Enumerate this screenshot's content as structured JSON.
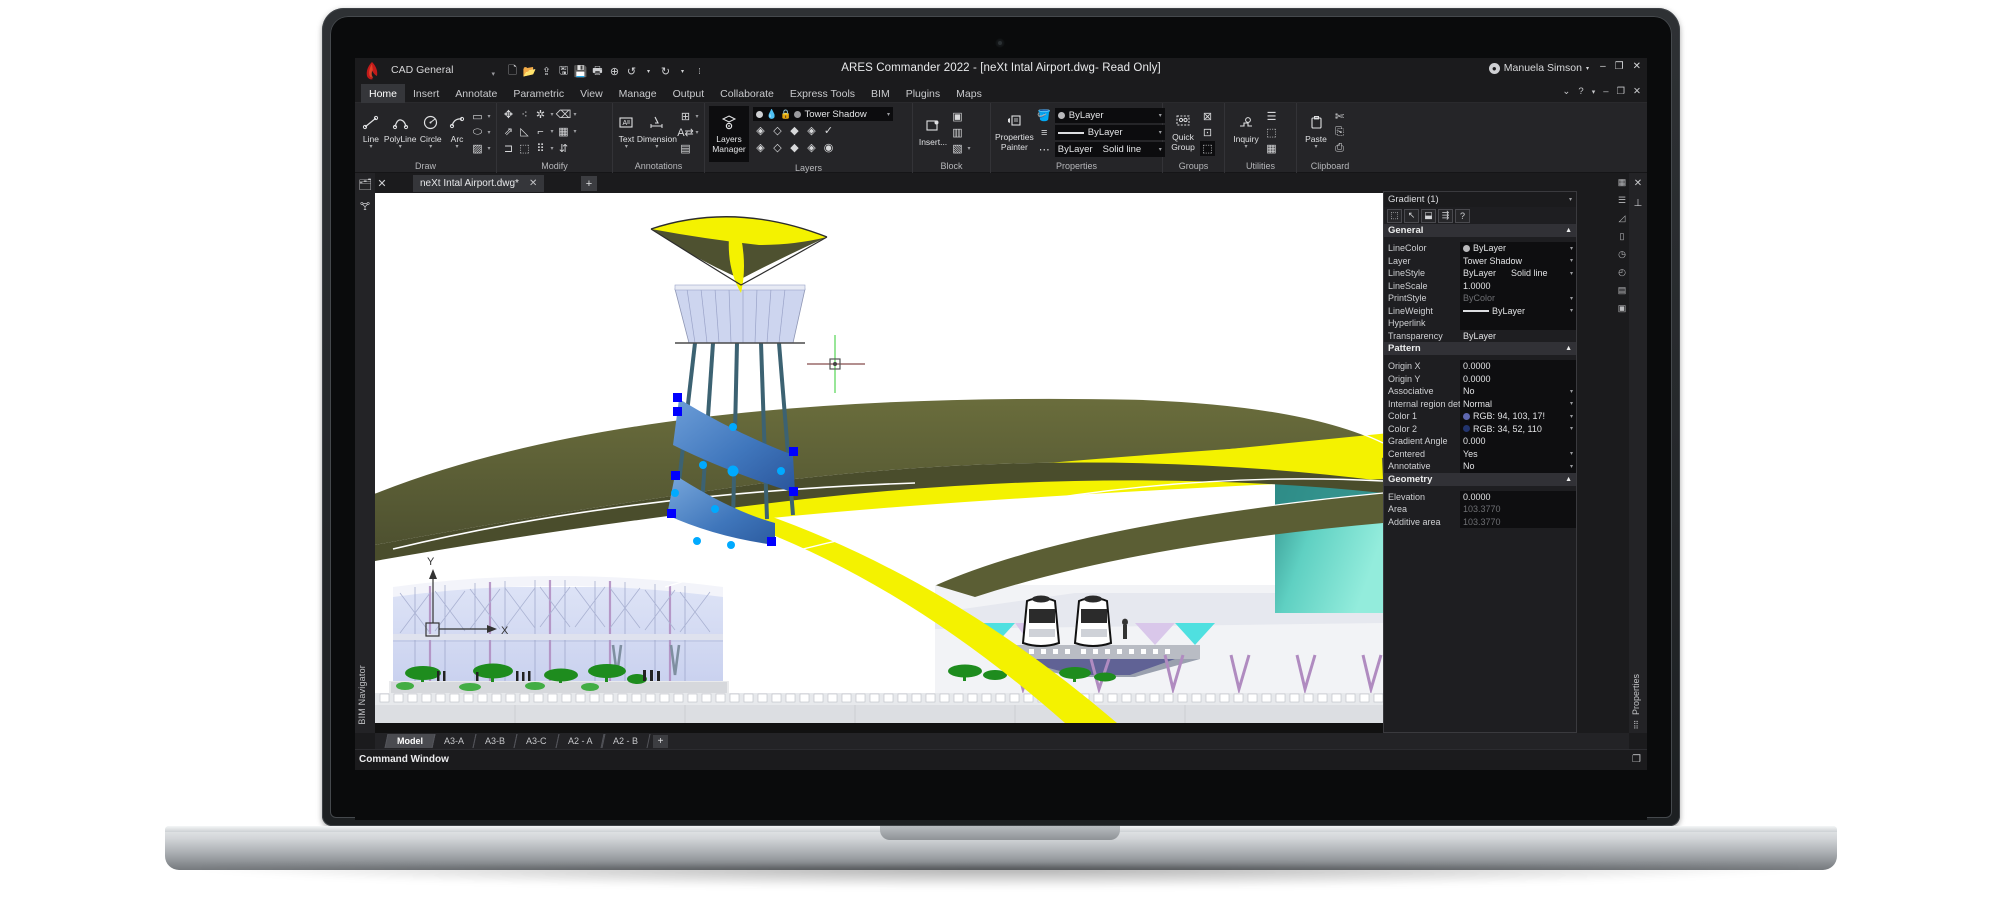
{
  "app": {
    "title": "ARES Commander 2022 - [neXt Intal Airport.dwg- Read Only]",
    "workspace": "CAD General",
    "user": "Manuela Simson",
    "user_icon": "user-circle-icon",
    "logo_icon": "ares-flame-logo"
  },
  "quick_access": [
    {
      "icon": "new-file-icon",
      "name": "new"
    },
    {
      "icon": "open-folder-icon",
      "name": "open"
    },
    {
      "icon": "open-recent-icon",
      "name": "open-recent"
    },
    {
      "icon": "save-as-icon",
      "name": "save-as"
    },
    {
      "icon": "save-icon",
      "name": "save"
    },
    {
      "icon": "print-icon",
      "name": "print"
    },
    {
      "icon": "print-preview-icon",
      "name": "print-preview"
    },
    {
      "icon": "undo-icon",
      "name": "undo"
    },
    {
      "icon": "caret-down-icon",
      "name": "undo-menu"
    },
    {
      "icon": "redo-icon",
      "name": "redo"
    },
    {
      "icon": "caret-down-icon",
      "name": "redo-menu"
    },
    {
      "icon": "more-icon",
      "name": "customize"
    }
  ],
  "window_buttons": {
    "minimize": "–",
    "restore": "❐",
    "close": "✕"
  },
  "ribbon_tabs": [
    {
      "label": "Home",
      "active": true
    },
    {
      "label": "Insert",
      "active": false
    },
    {
      "label": "Annotate",
      "active": false
    },
    {
      "label": "Parametric",
      "active": false
    },
    {
      "label": "View",
      "active": false
    },
    {
      "label": "Manage",
      "active": false
    },
    {
      "label": "Output",
      "active": false
    },
    {
      "label": "Collaborate",
      "active": false
    },
    {
      "label": "Express Tools",
      "active": false
    },
    {
      "label": "BIM",
      "active": false
    },
    {
      "label": "Plugins",
      "active": false
    },
    {
      "label": "Maps",
      "active": false
    }
  ],
  "ribbon_right": [
    "⌄",
    "?",
    "•",
    "–",
    "❐",
    "✕"
  ],
  "ribbon_groups": {
    "draw": {
      "label": "Draw",
      "big": [
        {
          "label": "Line",
          "icon": "line-icon"
        },
        {
          "label": "PolyLine",
          "icon": "polyline-icon"
        },
        {
          "label": "Circle",
          "icon": "circle-icon"
        },
        {
          "label": "Arc",
          "icon": "arc-icon"
        }
      ],
      "small": [
        {
          "icon": "rectangle-icon"
        },
        {
          "icon": "ellipse-icon"
        },
        {
          "icon": "hatch-icon"
        }
      ]
    },
    "modify": {
      "label": "Modify",
      "small": [
        {
          "icon": "move-icon"
        },
        {
          "icon": "copy-icon"
        },
        {
          "icon": "explode-icon"
        },
        {
          "icon": "erase-icon"
        },
        {
          "icon": "stretch-icon"
        },
        {
          "icon": "mirror-icon"
        },
        {
          "icon": "trim-icon"
        },
        {
          "icon": "fillet-icon"
        },
        {
          "icon": "offset-icon"
        },
        {
          "icon": "scale-icon"
        },
        {
          "icon": "array-icon"
        },
        {
          "icon": "align-icon"
        }
      ]
    },
    "annotations": {
      "label": "Annotations",
      "big": [
        {
          "label": "Text",
          "icon": "text-icon"
        },
        {
          "label": "Dimension",
          "icon": "dimension-icon"
        }
      ],
      "small": [
        {
          "icon": "table-icon"
        },
        {
          "icon": "text-style-icon"
        },
        {
          "icon": "table-style-icon"
        }
      ]
    },
    "layers": {
      "label": "Layers",
      "manager_label_line1": "Layers",
      "manager_label_line2": "Manager",
      "manager_icon": "layers-gear-icon",
      "current_layer": "Tower Shadow",
      "layer_state_icons": [
        "lamp-icon",
        "water-drop-icon",
        "lock-icon",
        "color-dot-icon"
      ],
      "tool_icons": [
        "layer-off-icon",
        "layer-freeze-icon",
        "layer-lock-icon",
        "layer-locked-icon",
        "layer-check-icon",
        "layer-on-icon",
        "layer-thaw-icon",
        "layer-isolate-icon",
        "layer-unlock-icon",
        "layer-previous-icon"
      ]
    },
    "block": {
      "label": "Block",
      "big": [
        {
          "label": "Insert...",
          "icon": "insert-block-icon"
        }
      ],
      "small": [
        {
          "icon": "create-block-icon"
        },
        {
          "icon": "edit-block-icon"
        },
        {
          "icon": "block-attributes-icon"
        }
      ]
    },
    "properties": {
      "label": "Properties",
      "big": [
        {
          "label_line1": "Properties",
          "label_line2": "Painter",
          "icon": "properties-painter-icon"
        }
      ],
      "small": [
        {
          "icon": "paint-bucket-icon"
        },
        {
          "icon": "lineweight-icon"
        },
        {
          "icon": "linestyle-icon"
        }
      ],
      "combos": [
        {
          "name": "line-color",
          "swatch": "#b9b9bc",
          "value": "ByLayer",
          "icon": "color-dot-icon"
        },
        {
          "name": "line-weight",
          "swatch": "",
          "value": "ByLayer",
          "icon": "line-weight-icon"
        },
        {
          "name": "line-style",
          "value": "ByLayer",
          "value2": "Solid line",
          "icon": "line-style-icon"
        }
      ]
    },
    "groups": {
      "label": "Groups",
      "big": [
        {
          "label_line1": "Quick",
          "label_line2": "Group",
          "icon": "quick-group-icon"
        }
      ],
      "small": [
        {
          "icon": "ungroup-icon"
        },
        {
          "icon": "group-edit-icon"
        },
        {
          "icon": "group-select-icon"
        }
      ]
    },
    "utilities": {
      "label": "Utilities",
      "big": [
        {
          "label": "Inquiry",
          "icon": "inquiry-icon"
        }
      ],
      "small": [
        {
          "icon": "list-icon"
        },
        {
          "icon": "measure-area-icon"
        },
        {
          "icon": "calculator-icon"
        }
      ]
    },
    "clipboard": {
      "label": "Clipboard",
      "big": [
        {
          "label": "Paste",
          "icon": "paste-icon"
        }
      ],
      "small": [
        {
          "icon": "cut-icon"
        },
        {
          "icon": "copy-clip-icon"
        },
        {
          "icon": "copy-base-icon"
        }
      ]
    }
  },
  "doc_bar": {
    "left_icons": [
      "project-browser-icon",
      "close-panel-icon"
    ],
    "tab_label": "neXt Intal Airport.dwg*",
    "tab_close": "✕",
    "new_tab": "+"
  },
  "left_rail": {
    "icons": [
      "drawing-explorer-icon",
      "structure-tree-icon"
    ],
    "vertical_label": "BIM Navigator"
  },
  "right_rail": {
    "close": "✕",
    "pin_icon": "pin-icon",
    "vertical_label": "Properties",
    "far_icons": [
      "snap-settings-icon",
      "osnap-icon",
      "ortho-icon",
      "grid-icon",
      "polar-icon",
      "dyn-icon",
      "lineweight-display-icon",
      "quickprops-icon"
    ]
  },
  "properties_panel": {
    "header": "Gradient (1)",
    "header_caret": "▾",
    "tool_icons": [
      "select-similar-icon",
      "pick-cursor-icon",
      "quick-select-icon",
      "select-filter-icon",
      "help-icon"
    ],
    "sections": [
      {
        "title": "General",
        "collapse": "▲",
        "rows": [
          {
            "key": "LineColor",
            "value": "ByLayer",
            "type": "combo",
            "swatch": "#b9b9bc"
          },
          {
            "key": "Layer",
            "value": "Tower Shadow",
            "type": "combo"
          },
          {
            "key": "LineStyle",
            "value": "ByLayer",
            "value2": "Solid line",
            "type": "combo"
          },
          {
            "key": "LineScale",
            "value": "1.0000",
            "type": "text"
          },
          {
            "key": "PrintStyle",
            "value": "ByColor",
            "type": "combo",
            "disabled": true
          },
          {
            "key": "LineWeight",
            "value": "ByLayer",
            "type": "lineweight"
          },
          {
            "key": "Hyperlink",
            "value": "",
            "type": "text"
          },
          {
            "key": "Transparency",
            "value": "ByLayer",
            "type": "plain"
          }
        ]
      },
      {
        "title": "Pattern",
        "collapse": "▲",
        "rows": [
          {
            "key": "Origin X",
            "value": "0.0000",
            "type": "text"
          },
          {
            "key": "Origin Y",
            "value": "0.0000",
            "type": "text"
          },
          {
            "key": "Associative",
            "value": "No",
            "type": "combo"
          },
          {
            "key": "Internal region det...",
            "value": "Normal",
            "type": "combo"
          },
          {
            "key": "Color 1",
            "value": "RGB: 94, 103, 17!",
            "type": "combo",
            "swatch": "#5e67af"
          },
          {
            "key": "Color 2",
            "value": "RGB: 34, 52, 110",
            "type": "combo",
            "swatch": "#22346e"
          },
          {
            "key": "Gradient Angle",
            "value": "0.000",
            "type": "text"
          },
          {
            "key": "Centered",
            "value": "Yes",
            "type": "combo"
          },
          {
            "key": "Annotative",
            "value": "No",
            "type": "combo"
          }
        ]
      },
      {
        "title": "Geometry",
        "collapse": "▲",
        "rows": [
          {
            "key": "Elevation",
            "value": "0.0000",
            "type": "text"
          },
          {
            "key": "Area",
            "value": "103.3770",
            "type": "text",
            "disabled": true
          },
          {
            "key": "Additive area",
            "value": "103.3770",
            "type": "text",
            "disabled": true
          }
        ]
      }
    ]
  },
  "layout_tabs": [
    {
      "label": "Model",
      "active": true
    },
    {
      "label": "A3-A",
      "active": false
    },
    {
      "label": "A3-B",
      "active": false
    },
    {
      "label": "A3-C",
      "active": false
    },
    {
      "label": "A2 - A",
      "active": false
    },
    {
      "label": "A2 - B",
      "active": false
    }
  ],
  "layout_tabs_add": "+",
  "command_window": {
    "label": "Command Window",
    "icon": "dock-icon"
  },
  "canvas": {
    "description": "3D airport rendering: control tower with yellow canopy roof, olive/yellow curved terminal roof, glass terminal facade, trees, people, monorail trains, teal gradient panel",
    "colors": {
      "roof_olive": "#595c32",
      "roof_yellow": "#f4f200",
      "tower_glass": "#cdd5ef",
      "gradient_blue_light": "#4f86c6",
      "gradient_blue_dark": "#2f5f9e",
      "teal_light": "#7fe3d4",
      "teal_dark": "#2f8c85",
      "tree_green": "#1e8c1e",
      "grip_blue": "#0000ff",
      "grip_cyan": "#00aaff",
      "cursor_green": "#7ee07e",
      "glass_blue": "#ccd4f0",
      "mullion_purple": "#b08bc0"
    },
    "selection_grips_count": 14,
    "ucs": {
      "x_label": "X",
      "y_label": "Y"
    }
  }
}
